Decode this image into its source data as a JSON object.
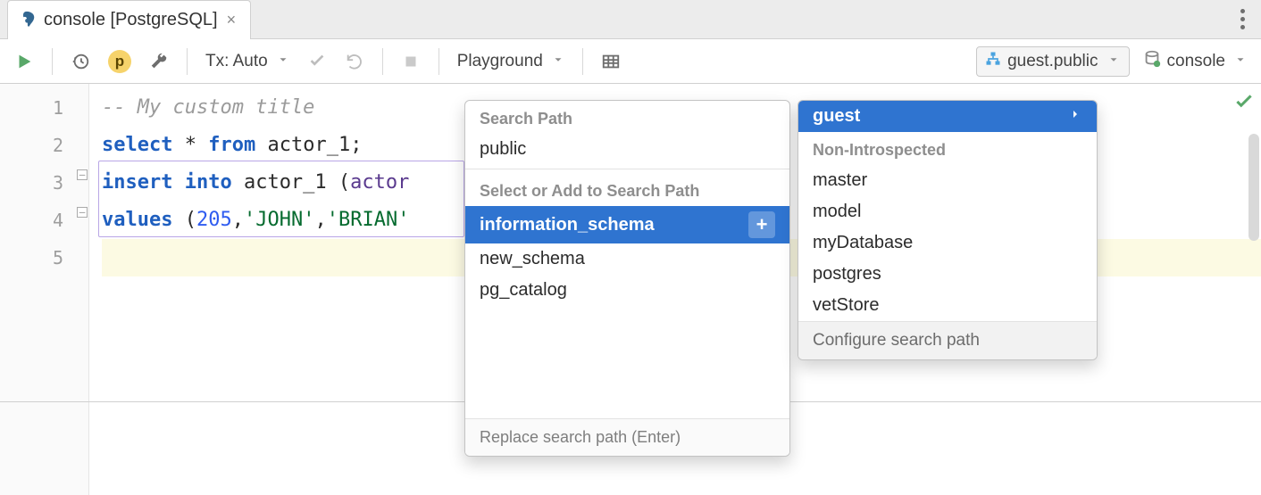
{
  "tab": {
    "title": "console [PostgreSQL]"
  },
  "toolbar": {
    "tx_label": "Tx: Auto",
    "playground_label": "Playground",
    "schema_label": "guest.public",
    "console_label": "console"
  },
  "editor": {
    "lines": {
      "n1": "1",
      "n2": "2",
      "n3": "3",
      "n4": "4",
      "n5": "5",
      "l1_comment": "-- My custom title",
      "l2_kw1": "select",
      "l2_star": "*",
      "l2_kw2": "from",
      "l2_id": "actor_1",
      "l2_semi": ";",
      "l3_kw": "insert into",
      "l3_id": "actor_1",
      "l3_open": " (",
      "l3_col": "actor",
      "l4_kw": "values",
      "l4_open": " (",
      "l4_num": "205",
      "l4_c1": ",",
      "l4_s1": "'JOHN'",
      "l4_c2": ",",
      "l4_s2": "'BRIAN'"
    }
  },
  "popup1": {
    "hdr1": "Search Path",
    "current": "public",
    "hdr2": "Select or Add to Search Path",
    "items": {
      "i0": "information_schema",
      "i1": "new_schema",
      "i2": "pg_catalog"
    },
    "footer": "Replace search path (Enter)"
  },
  "popup2": {
    "selected": "guest",
    "hdr": "Non-Introspected",
    "items": {
      "d0": "master",
      "d1": "model",
      "d2": "myDatabase",
      "d3": "postgres",
      "d4": "vetStore"
    },
    "footer": "Configure search path"
  }
}
